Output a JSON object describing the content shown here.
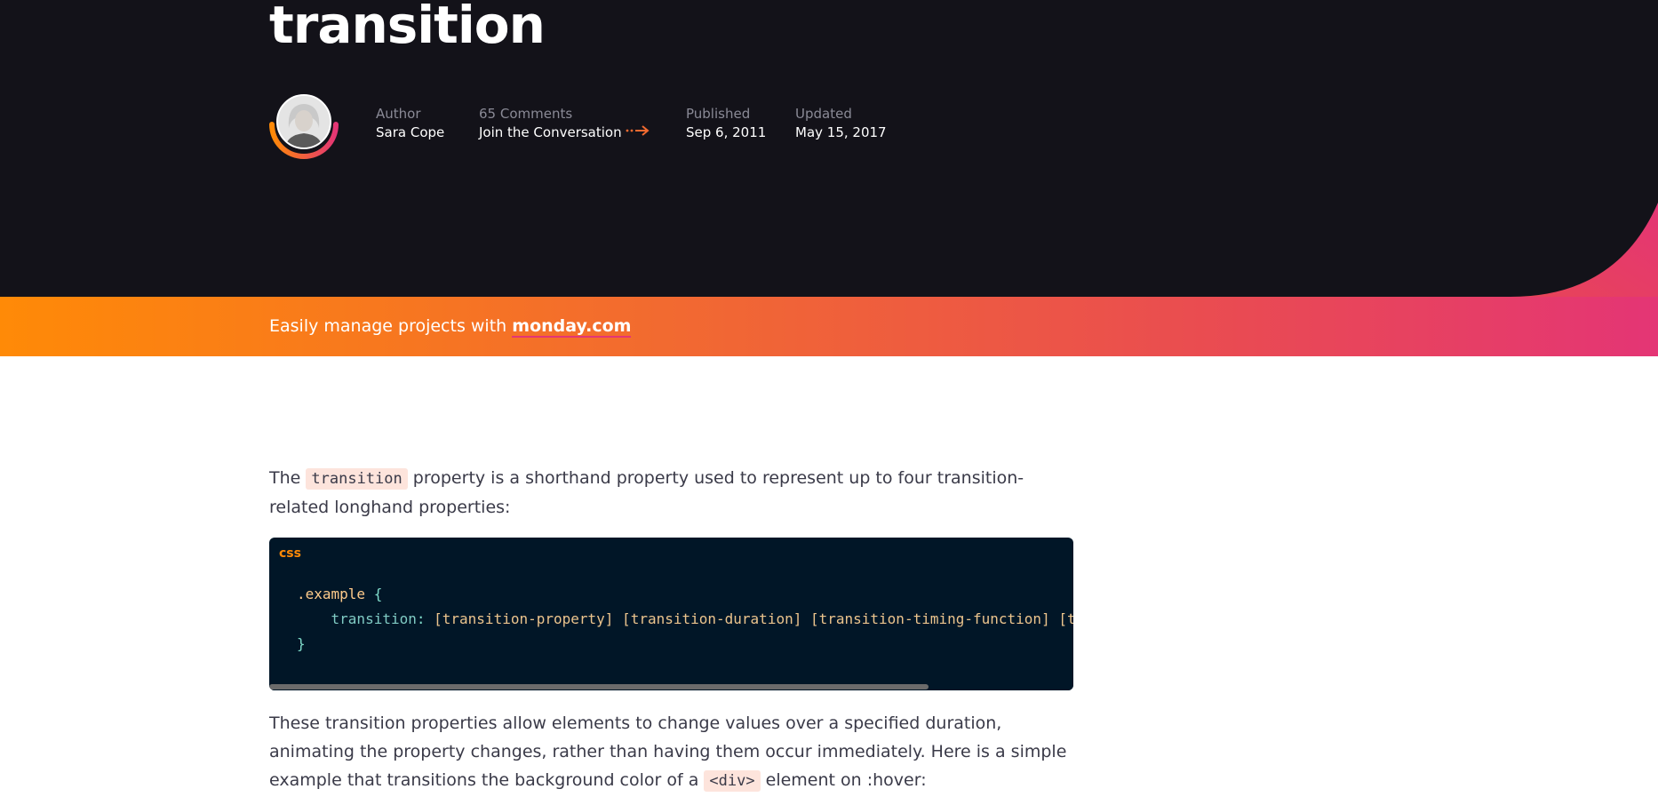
{
  "hero": {
    "title": "transition",
    "author_label": "Author",
    "author_name": "Sara Cope",
    "comments_label": "65 Comments",
    "comments_link": "Join the Conversation",
    "published_label": "Published",
    "published_date": "Sep 6, 2011",
    "updated_label": "Updated",
    "updated_date": "May 15, 2017"
  },
  "banner": {
    "text": "Easily manage projects with",
    "link": "monday.com"
  },
  "article": {
    "p1_start": "The",
    "p1_code": "transition",
    "p1_end": "property is a shorthand property used to represent up to four transition-related longhand properties:",
    "code_lang": "css",
    "code_line1_selector": ".example",
    "code_line1_brace": " {",
    "code_line2_prop": "transition",
    "code_line2_colon": ":",
    "code_line2_value": " [transition-property] [transition-duration] [transition-timing-function] [transition-delay];",
    "code_line3_brace": "}",
    "p2_start": "These transition properties allow elements to change values over a specified duration, animating the property changes, rather than having them occur immediately. Here is a simple example that transitions the background color of a",
    "p2_code": "<div>",
    "p2_end": "element on :hover:"
  },
  "colors": {
    "hero_bg": "#131219",
    "accent_orange": "#ff8a07",
    "accent_pink": "#e43575",
    "code_bg": "#011627"
  },
  "icons": {
    "avatar": "author-avatar",
    "arrow": "dotted-arrow-right-icon"
  },
  "code_scroll": {
    "thumb_fraction": 0.82
  }
}
